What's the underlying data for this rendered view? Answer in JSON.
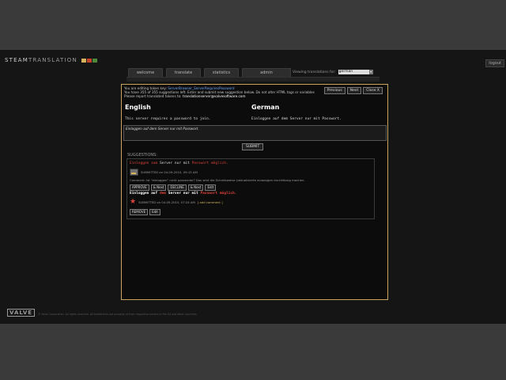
{
  "header": {
    "logo_text_a": "STEAM",
    "logo_text_b": "TRANSLATION",
    "flag_colors": [
      "#d8b35e",
      "#c8432d",
      "#4c8a3a"
    ],
    "logout_label": "logout"
  },
  "nav": {
    "tabs": [
      {
        "label": "welcome"
      },
      {
        "label": "translate"
      },
      {
        "label": "statistics"
      },
      {
        "label": "admin"
      }
    ],
    "language_label": "Viewing translations for:",
    "language_value": "german"
  },
  "modal": {
    "line1_prefix": "You are editing token key:",
    "token_key": "ServerBrowser_ServerRequiresPassword",
    "line2": "You have 355 of 355 suggestions left. Enter and submit new suggestion below. Do not alter HTML tags or variables",
    "line3_prefix": "Please report translated tokens to:",
    "report_email": "translationserver@valvesoftware.com",
    "buttons": {
      "previous": "Previous",
      "next": "Next",
      "close": "Close X"
    },
    "source_title": "English",
    "target_title": "German",
    "source_text": "This server requires a password to join.",
    "target_text": "Einloggen auf dem Server nur mit Passwort.",
    "textarea_value": "Einloggen auf dem Server nur mit Passwort.",
    "submit_label": "SUBMIT",
    "suggestions_label": "SUGGESTIONS:",
    "suggestion1": {
      "part1": "Einloggen zum",
      "part2": " Server nur mit ",
      "part3": "Passwort möglich.",
      "submitted": "SUBMITTED on 04-09-2010, 09:15 AM",
      "comment": "Comment: Ist \"einloggen\" nicht passender? Das wird die Schreibweise (aktualisierte zulassigen durchlässig machen.",
      "actions": [
        "APPROVE",
        "& Next",
        "DECLINE",
        "& Next",
        "Edit"
      ]
    },
    "suggestion2": {
      "part1": "Einloggen auf ",
      "part2": "dem",
      "part3": " Server nur mit ",
      "part4": "Passwort möglich.",
      "submitted": "SUBMITTED on 04-09-2010, 07:24 AM",
      "add_comment": "[ add comment ]",
      "actions": [
        "REMOVE",
        "Edit"
      ]
    }
  },
  "footer": {
    "valve_logo": "VALVE",
    "copyright": "© Valve Corporation. All rights reserved. All trademarks are property of their respective owners in the US and other countries."
  }
}
